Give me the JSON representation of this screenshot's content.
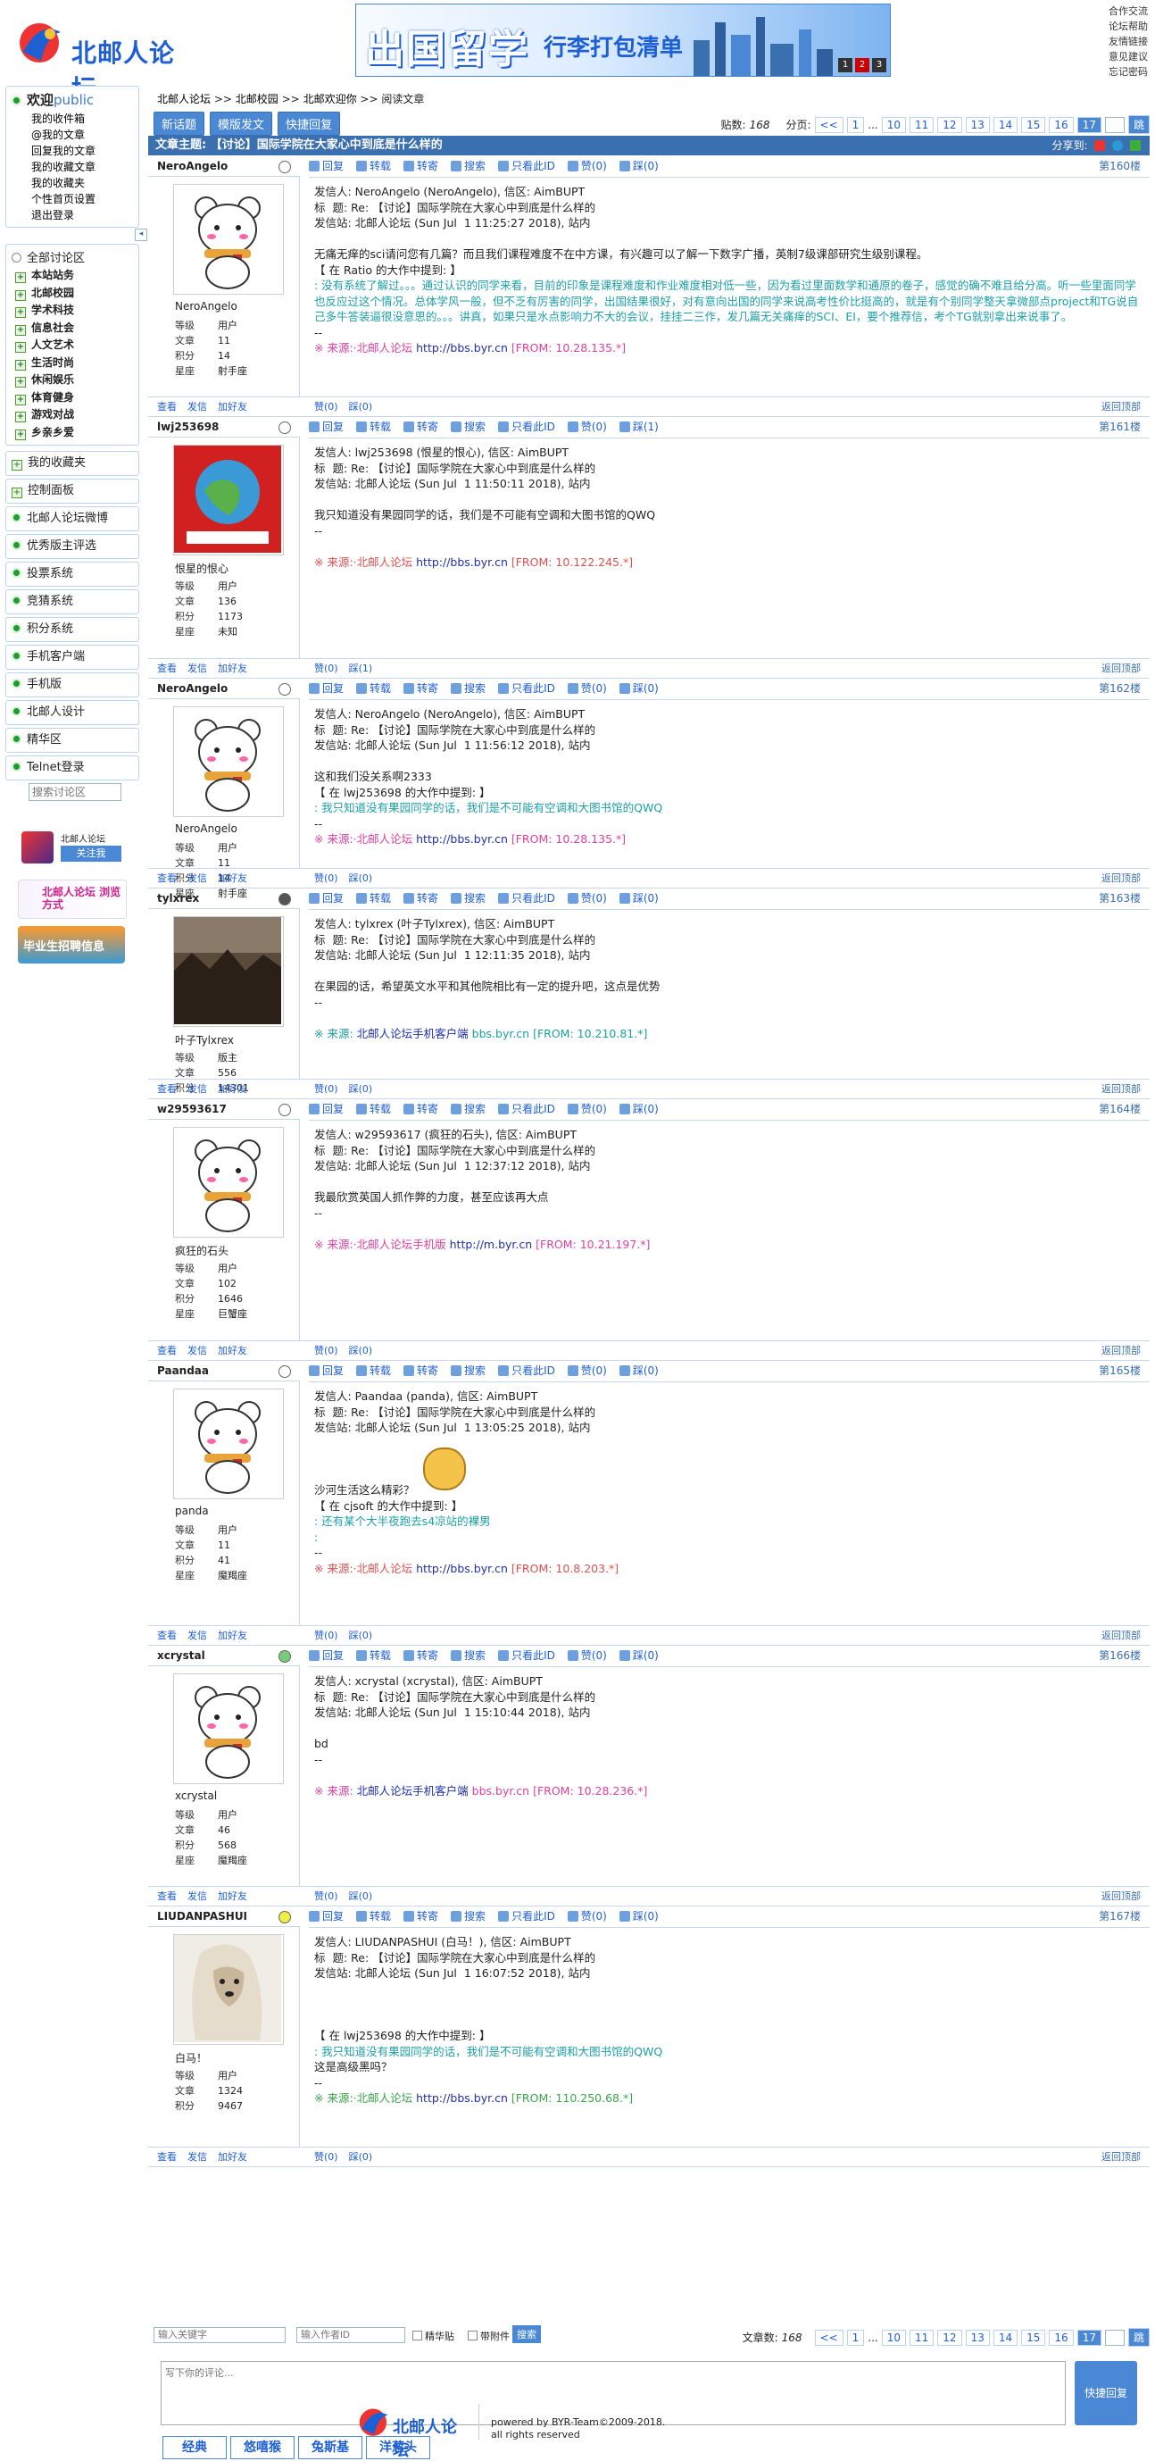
{
  "site": {
    "name": "北邮人论坛"
  },
  "banner": {
    "title": "出国留学",
    "subtitle": "行李打包清单",
    "pages": [
      "1",
      "2",
      "3"
    ],
    "active_page": "2"
  },
  "top_links": [
    "合作交流",
    "论坛帮助",
    "友情链接",
    "意见建议",
    "忘记密码"
  ],
  "sidebar": {
    "welcome": "欢迎",
    "user": "public",
    "user_links": [
      "我的收件箱",
      "@我的文章",
      "回复我的文章",
      "我的收藏文章",
      "我的收藏夹",
      "个性首页设置",
      "退出登录"
    ],
    "all_boards": "全部讨论区",
    "boards": [
      "本站站务",
      "北邮校园",
      "学术科技",
      "信息社会",
      "人文艺术",
      "生活时尚",
      "休闲娱乐",
      "体育健身",
      "游戏对战",
      "乡亲乡爱"
    ],
    "nav": [
      "我的收藏夹",
      "控制面板",
      "北邮人论坛微博",
      "优秀版主评选",
      "投票系统",
      "竞猜系统",
      "积分系统",
      "手机客户端",
      "手机版",
      "北邮人设计",
      "精华区",
      "Telnet登录"
    ],
    "search_placeholder": "搜索讨论区",
    "follow_title": "北邮人论坛",
    "follow_btn": "关注我",
    "promo1": "北邮人论坛 浏览方式",
    "promo2": "毕业生招聘信息"
  },
  "breadcrumb": [
    "北邮人论坛",
    ">>",
    "北邮校园",
    ">>",
    "北邮欢迎你",
    ">>",
    "阅读文章"
  ],
  "actions": [
    "新话题",
    "模版发文",
    "快捷回复"
  ],
  "pager": {
    "count_label": "贴数:",
    "count": "168",
    "pages_label": "分页:",
    "prev": "<<",
    "ellipsis": "...",
    "pages": [
      "1",
      "10",
      "11",
      "12",
      "13",
      "14",
      "15",
      "16",
      "17"
    ],
    "current": "17",
    "go": "跳"
  },
  "article_title": "文章主题: 【讨论】国际学院在大家心中到底是什么样的",
  "share_label": "分享到:",
  "post_tools": [
    "回复",
    "转载",
    "转寄",
    "搜索",
    "只看此ID"
  ],
  "foot_links": [
    "查看",
    "发信",
    "加好友"
  ],
  "back_top": "返回顶部",
  "stat_keys": [
    "等级",
    "文章",
    "积分",
    "星座"
  ],
  "posts": [
    {
      "id": "NeroAngelo",
      "nick": "NeroAngelo",
      "level": "用户",
      "posts": "11",
      "score": "14",
      "star": "射手座",
      "floor": "第160楼",
      "head1": "发信人: NeroAngelo (NeroAngelo), 信区: AimBUPT",
      "head2": "标  题: Re: 【讨论】国际学院在大家心中到底是什么样的",
      "head3": "发信站: 北邮人论坛 (Sun Jul  1 11:25:27 2018), 站内",
      "text": "无痛无痒的sci请问您有几篇？而且我们课程难度不在中方课，有兴趣可以了解一下数字广播，英制7级课部研究生级别课程。\n【 在 Ratio 的大作中提到: 】",
      "quote": ": 没有系统了解过。。。通过认识的同学来看，目前的印象是课程难度和作业难度相对低一些，因为看过里面数学和通原的卷子，感觉的确不难且给分高。听一些里面同学也反应过这个情况。总体学风一般，但不乏有厉害的同学，出国结果很好，对有意向出国的同学来说高考性价比挺高的，就是有个别同学整天拿微部点project和TG说自己多牛答装逼很没意思的。。。讲真，如果只是水点影响力不大的会议，挂挂二三作，发几篇无关痛痒的SCI、EI，要个推荐信，考个TG就别拿出来说事了。",
      "tail": "\n--\n",
      "src_label": "※ 来源:·北邮人论坛",
      "src_link": "http://bbs.byr.cn",
      "src_from": "[FROM: 10.28.135.*]",
      "src_class": "src1",
      "like": "赞(0)",
      "dislike": "踩(0)"
    },
    {
      "id": "lwj253698",
      "nick": "恨星的恨心",
      "level": "用户",
      "posts": "136",
      "score": "1173",
      "star": "未知",
      "floor": "第161楼",
      "head1": "发信人: lwj253698 (恨星的恨心), 信区: AimBUPT",
      "head2": "标  题: Re: 【讨论】国际学院在大家心中到底是什么样的",
      "head3": "发信站: 北邮人论坛 (Sun Jul  1 11:50:11 2018), 站内",
      "text": "我只知道没有果园同学的话，我们是不可能有空调和大图书馆的QWQ\n--",
      "quote": "",
      "tail": "",
      "src_label": "※ 来源:·北邮人论坛",
      "src_link": "http://bbs.byr.cn",
      "src_from": "[FROM: 10.122.245.*]",
      "src_class": "src3",
      "like": "赞(0)",
      "dislike": "踩(1)"
    },
    {
      "id": "NeroAngelo",
      "nick": "NeroAngelo",
      "level": "用户",
      "posts": "11",
      "score": "14",
      "star": "射手座",
      "floor": "第162楼",
      "head1": "发信人: NeroAngelo (NeroAngelo), 信区: AimBUPT",
      "head2": "标  题: Re: 【讨论】国际学院在大家心中到底是什么样的",
      "head3": "发信站: 北邮人论坛 (Sun Jul  1 11:56:12 2018), 站内",
      "text": "这和我们没关系啊2333\n【 在 lwj253698 的大作中提到: 】",
      "quote": ": 我只知道没有果园同学的话，我们是不可能有空调和大图书馆的QWQ",
      "tail": "\n--\n",
      "src_label": "※ 来源:·北邮人论坛",
      "src_link": "http://bbs.byr.cn",
      "src_from": "[FROM: 10.28.135.*]",
      "src_class": "src1",
      "like": "赞(0)",
      "dislike": "踩(0)"
    },
    {
      "id": "tylxrex",
      "nick": "叶子Tylxrex",
      "level": "版主",
      "posts": "556",
      "score": "14301",
      "star": "",
      "floor": "第163楼",
      "head1": "发信人: tylxrex (叶子Tylxrex), 信区: AimBUPT",
      "head2": "标  题: Re: 【讨论】国际学院在大家心中到底是什么样的",
      "head3": "发信站: 北邮人论坛 (Sun Jul  1 12:11:35 2018), 站内",
      "text": "在果园的话，希望英文水平和其他院相比有一定的提升吧，这点是优势\n--",
      "quote": "",
      "tail": "",
      "src_label": "※ 来源:",
      "src_link": "北邮人论坛手机客户端",
      "src_from": "bbs.byr.cn [FROM: 10.210.81.*]",
      "src_class": "src2",
      "like": "赞(0)",
      "dislike": "踩(0)"
    },
    {
      "id": "w29593617",
      "nick": "疯狂的石头",
      "level": "用户",
      "posts": "102",
      "score": "1646",
      "star": "巨蟹座",
      "floor": "第164楼",
      "head1": "发信人: w29593617 (疯狂的石头), 信区: AimBUPT",
      "head2": "标  题: Re: 【讨论】国际学院在大家心中到底是什么样的",
      "head3": "发信站: 北邮人论坛 (Sun Jul  1 12:37:12 2018), 站内",
      "text": "我最欣赏英国人抓作弊的力度，甚至应该再大点\n--",
      "quote": "",
      "tail": "",
      "src_label": "※ 来源:·北邮人论坛手机版",
      "src_link": "http://m.byr.cn",
      "src_from": "[FROM: 10.21.197.*]",
      "src_class": "src1",
      "like": "赞(0)",
      "dislike": "踩(0)"
    },
    {
      "id": "Paandaa",
      "nick": "panda",
      "level": "用户",
      "posts": "11",
      "score": "41",
      "star": "魔羯座",
      "floor": "第165楼",
      "head1": "发信人: Paandaa (panda), 信区: AimBUPT",
      "head2": "标  题: Re: 【讨论】国际学院在大家心中到底是什么样的",
      "head3": "发信站: 北邮人论坛 (Sun Jul  1 13:05:25 2018), 站内",
      "text": "\n\n沙河生活这么精彩？\n【 在 cjsoft 的大作中提到: 】",
      "quote": ": 还有某个大半夜跑去s4凉站的裸男\n:",
      "tail": "\n--\n",
      "src_label": "※ 来源:·北邮人论坛",
      "src_link": "http://bbs.byr.cn",
      "src_from": "[FROM: 10.8.203.*]",
      "src_class": "src3",
      "like": "赞(0)",
      "dislike": "踩(0)"
    },
    {
      "id": "xcrystal",
      "nick": "xcrystal",
      "level": "用户",
      "posts": "46",
      "score": "568",
      "star": "魔羯座",
      "floor": "第166楼",
      "head1": "发信人: xcrystal (xcrystal), 信区: AimBUPT",
      "head2": "标  题: Re: 【讨论】国际学院在大家心中到底是什么样的",
      "head3": "发信站: 北邮人论坛 (Sun Jul  1 15:10:44 2018), 站内",
      "text": "bd\n--",
      "quote": "",
      "tail": "",
      "src_label": "※ 来源:",
      "src_link": "北邮人论坛手机客户端",
      "src_from": "bbs.byr.cn [FROM: 10.28.236.*]",
      "src_class": "src1",
      "like": "赞(0)",
      "dislike": "踩(0)"
    },
    {
      "id": "LIUDANPASHUI",
      "nick": "白马！",
      "level": "用户",
      "posts": "1324",
      "score": "9467",
      "star": "",
      "floor": "第167楼",
      "head1": "发信人: LIUDANPASHUI (白马！), 信区: AimBUPT",
      "head2": "标  题: Re: 【讨论】国际学院在大家心中到底是什么样的",
      "head3": "发信站: 北邮人论坛 (Sun Jul  1 16:07:52 2018), 站内",
      "text": "\n\n【 在 lwj253698 的大作中提到: 】",
      "quote": ": 我只知道没有果园同学的话，我们是不可能有空调和大图书馆的QWQ",
      "tail": "\n这是高级黑吗？\n--\n",
      "src_label": "※ 来源:·北邮人论坛",
      "src_link": "http://bbs.byr.cn",
      "src_from": "[FROM: 110.250.68.*]",
      "src_class": "src4",
      "like": "赞(0)",
      "dislike": "踩(0)"
    }
  ],
  "bottom": {
    "keyword_placeholder": "输入关键字",
    "author_placeholder": "输入作者ID",
    "digest": "精华贴",
    "attach": "带附件",
    "search_btn": "搜索",
    "count_label": "文章数:",
    "count": "168"
  },
  "reply": {
    "placeholder": "写下你的评论...",
    "button": "快捷回复",
    "emoticons": [
      "经典",
      "悠嘻猴",
      "兔斯基",
      "洋葱头"
    ]
  },
  "footer": {
    "line1": "powered by BYR-Team©2009-2018.",
    "line2": "all rights reserved"
  }
}
